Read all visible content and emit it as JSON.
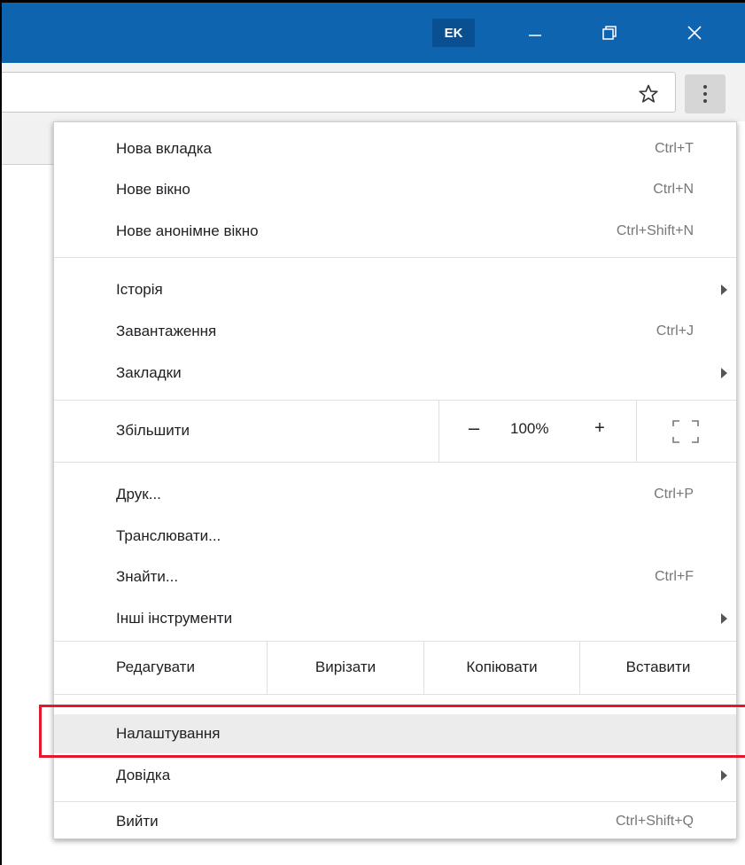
{
  "titlebar": {
    "language": "EK"
  },
  "icons": {
    "minimize": "minimize-icon",
    "restore": "restore-icon",
    "close": "close-icon",
    "star": "star-icon",
    "menu": "more-vert-icon"
  },
  "menu": {
    "group1": [
      {
        "label": "Нова вкладка",
        "shortcut": "Ctrl+T"
      },
      {
        "label": "Нове вікно",
        "shortcut": "Ctrl+N"
      },
      {
        "label": "Нове анонімне вікно",
        "shortcut": "Ctrl+Shift+N"
      }
    ],
    "group2": [
      {
        "label": "Історія",
        "shortcut": ""
      },
      {
        "label": "Завантаження",
        "shortcut": "Ctrl+J"
      },
      {
        "label": "Закладки",
        "shortcut": ""
      }
    ],
    "zoom": {
      "label": "Збільшити",
      "minus": "–",
      "value": "100%",
      "plus": "+"
    },
    "group3": [
      {
        "label": "Друк...",
        "shortcut": "Ctrl+P"
      },
      {
        "label": "Транслювати...",
        "shortcut": ""
      },
      {
        "label": "Знайти...",
        "shortcut": "Ctrl+F"
      },
      {
        "label": "Інші інструменти",
        "shortcut": ""
      }
    ],
    "edit": {
      "label": "Редагувати",
      "cut": "Вирізати",
      "copy": "Копіювати",
      "paste": "Вставити"
    },
    "group4": [
      {
        "label": "Налаштування",
        "shortcut": ""
      },
      {
        "label": "Довідка",
        "shortcut": ""
      }
    ],
    "exit": {
      "label": "Вийти",
      "shortcut": "Ctrl+Shift+Q"
    }
  },
  "colors": {
    "titlebar": "#0f64b0",
    "highlight_border": "#e3182d"
  }
}
